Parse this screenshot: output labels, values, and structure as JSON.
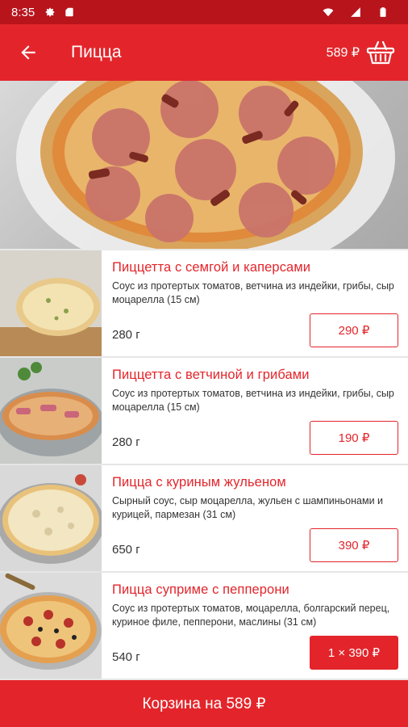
{
  "status": {
    "time": "8:35"
  },
  "appbar": {
    "title": "Пицца",
    "cart_total": "589 ₽"
  },
  "items": [
    {
      "name": "Пиццетта с семгой и каперсами",
      "desc": "Соус из протертых томатов, ветчина из индейки, грибы, сыр моцарелла (15 см)",
      "weight": "280 г",
      "price": "290 ₽"
    },
    {
      "name": "Пиццетта с ветчиной и грибами",
      "desc": "Соус из протертых томатов, ветчина из индейки, грибы, сыр моцарелла (15 см)",
      "weight": "280 г",
      "price": "190 ₽"
    },
    {
      "name": "Пицца с куриным жульеном",
      "desc": "Сырный соус, сыр моцарелла, жульен с шампиньонами и курицей, пармезан (31 см)",
      "weight": "650 г",
      "price": "390 ₽"
    },
    {
      "name": "Пицца суприме с пепперони",
      "desc": "Соус из протертых томатов, моцарелла, болгарский перец, куриное филе, пепперони, маслины (31 см)",
      "weight": "540 г",
      "price": "1 × 390 ₽"
    }
  ],
  "basket": {
    "label": "Корзина на 589 ₽"
  },
  "colors": {
    "primary": "#e3252b",
    "status": "#b8141c"
  }
}
